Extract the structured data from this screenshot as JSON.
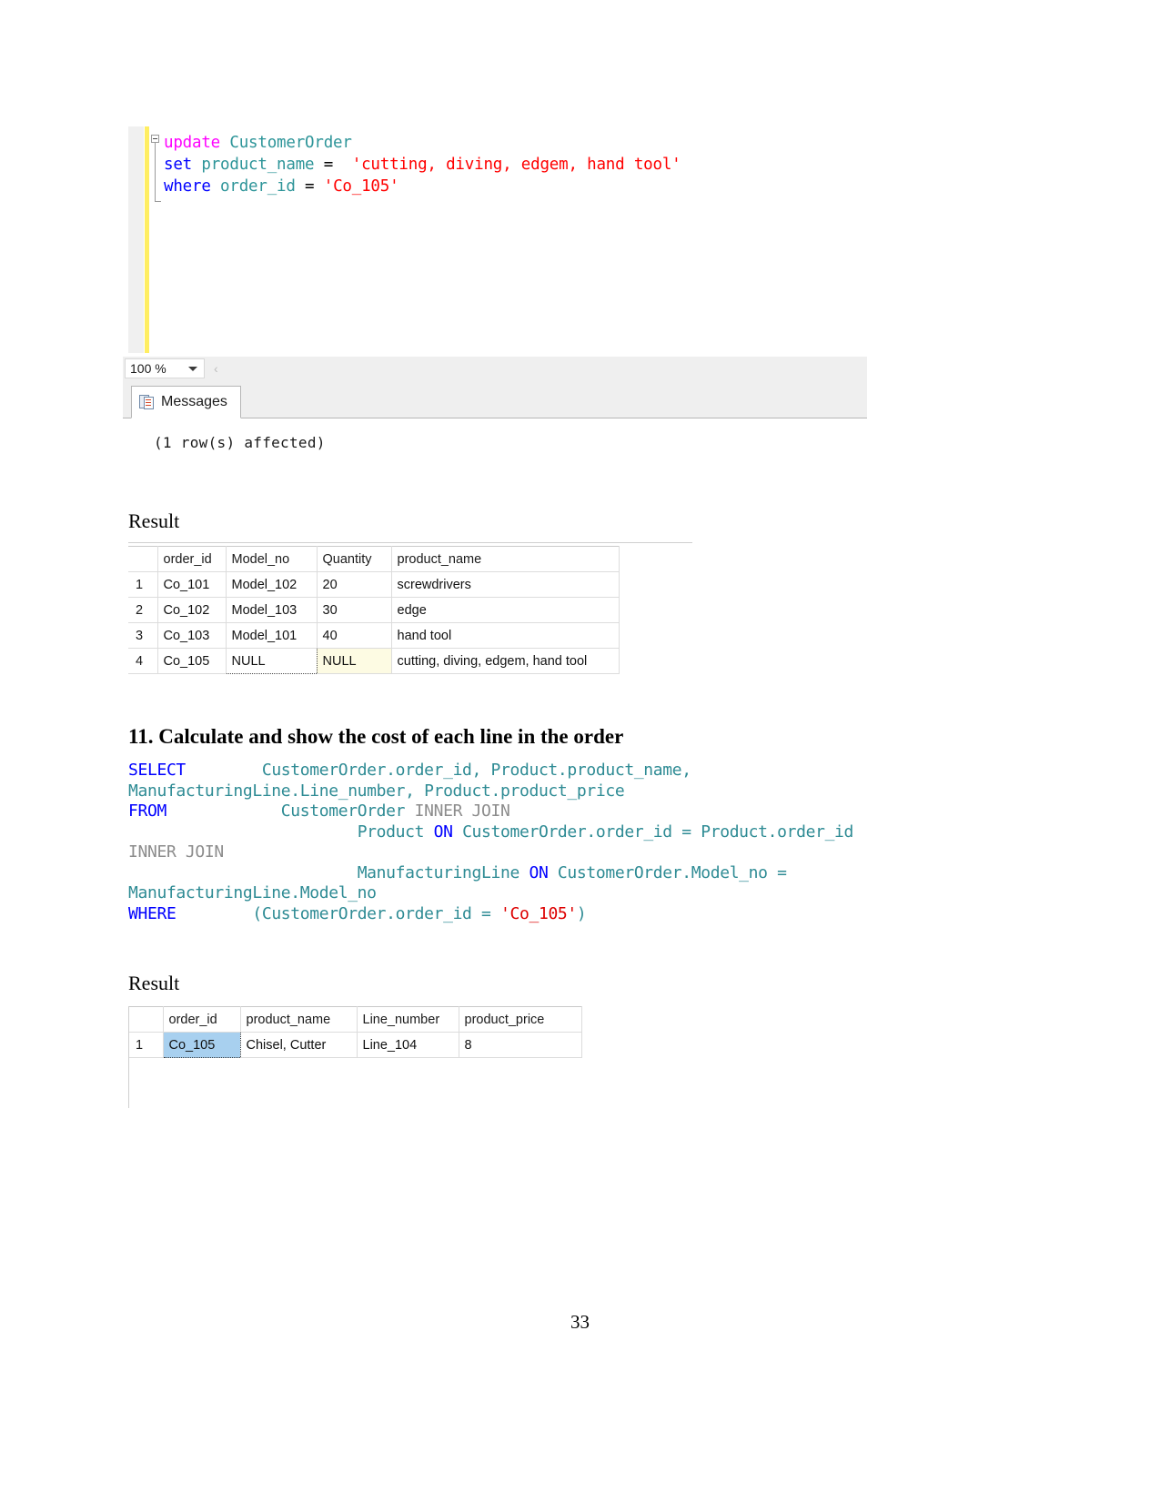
{
  "editor": {
    "lines": [
      [
        {
          "t": "update",
          "c": "magenta"
        },
        {
          "t": " ",
          "c": "black"
        },
        {
          "t": "CustomerOrder",
          "c": "teal"
        }
      ],
      [
        {
          "t": "set",
          "c": "blue"
        },
        {
          "t": " ",
          "c": "black"
        },
        {
          "t": "product_name",
          "c": "teal"
        },
        {
          "t": " = ",
          "c": "black"
        },
        {
          "t": " 'cutting, diving, edgem, hand tool'",
          "c": "str"
        }
      ],
      [
        {
          "t": "where",
          "c": "blue"
        },
        {
          "t": " ",
          "c": "black"
        },
        {
          "t": "order_id",
          "c": "teal"
        },
        {
          "t": " = ",
          "c": "black"
        },
        {
          "t": "'Co_105'",
          "c": "str"
        }
      ]
    ]
  },
  "status_bar": {
    "zoom_value": "100 %",
    "scroll_arrow": "‹"
  },
  "results_pane": {
    "tab_label": "Messages",
    "message_text": "(1 row(s) affected)"
  },
  "result_caption_1": "Result",
  "table1": {
    "headers": [
      "",
      "order_id",
      "Model_no",
      "Quantity",
      "product_name"
    ],
    "rows": [
      {
        "num": "1",
        "order_id": "Co_101",
        "model_no": "Model_102",
        "quantity": "20",
        "product_name": "screwdrivers"
      },
      {
        "num": "2",
        "order_id": "Co_102",
        "model_no": "Model_103",
        "quantity": "30",
        "product_name": "edge"
      },
      {
        "num": "3",
        "order_id": "Co_103",
        "model_no": "Model_101",
        "quantity": "40",
        "product_name": "hand tool"
      },
      {
        "num": "4",
        "order_id": "Co_105",
        "model_no": "NULL",
        "quantity": "NULL",
        "product_name": "cutting, diving, edgem, hand tool"
      }
    ]
  },
  "question": {
    "heading": "11. Calculate and show the cost of each line in the order"
  },
  "sql": {
    "lines": [
      [
        {
          "t": "SELECT",
          "c": "blue"
        },
        {
          "t": "        ",
          "c": "black"
        },
        {
          "t": "CustomerOrder.order_id, Product.product_name,",
          "c": "teal"
        }
      ],
      [
        {
          "t": "ManufacturingLine.Line_number, Product.product_price",
          "c": "teal"
        }
      ],
      [
        {
          "t": "FROM",
          "c": "blue"
        },
        {
          "t": "            ",
          "c": "black"
        },
        {
          "t": "CustomerOrder ",
          "c": "teal"
        },
        {
          "t": "INNER JOIN",
          "c": "grey"
        }
      ],
      [
        {
          "t": "                        ",
          "c": "black"
        },
        {
          "t": "Product ",
          "c": "teal"
        },
        {
          "t": "ON",
          "c": "blue"
        },
        {
          "t": " CustomerOrder.order_id = Product.order_id",
          "c": "teal"
        }
      ],
      [
        {
          "t": "INNER JOIN",
          "c": "grey"
        }
      ],
      [
        {
          "t": "                        ",
          "c": "black"
        },
        {
          "t": "ManufacturingLine ",
          "c": "teal"
        },
        {
          "t": "ON",
          "c": "blue"
        },
        {
          "t": " CustomerOrder.Model_no =",
          "c": "teal"
        }
      ],
      [
        {
          "t": "ManufacturingLine.Model_no",
          "c": "teal"
        }
      ],
      [
        {
          "t": "WHERE",
          "c": "blue"
        },
        {
          "t": "        ",
          "c": "black"
        },
        {
          "t": "(CustomerOrder.order_id = ",
          "c": "teal"
        },
        {
          "t": "'Co_105'",
          "c": "red"
        },
        {
          "t": ")",
          "c": "teal"
        }
      ]
    ]
  },
  "result_caption_2": "Result",
  "table2": {
    "headers": [
      "",
      "order_id",
      "product_name",
      "Line_number",
      "product_price"
    ],
    "rows": [
      {
        "num": "1",
        "order_id": "Co_105",
        "product_name": "Chisel, Cutter",
        "line_number": "Line_104",
        "product_price": "8"
      }
    ]
  },
  "page_number": "33"
}
